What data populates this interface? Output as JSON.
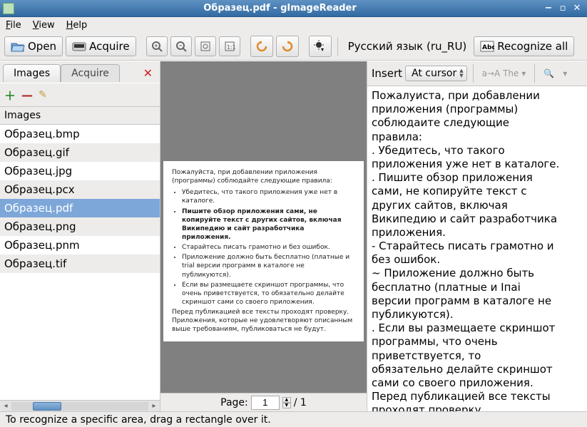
{
  "window": {
    "title": "Образец.pdf - gImageReader"
  },
  "menu": {
    "file": "File",
    "view": "View",
    "help": "Help"
  },
  "toolbar": {
    "open": "Open",
    "acquire": "Acquire",
    "language": "Русский язык (ru_RU)",
    "recognize_all": "Recognize all"
  },
  "sidebar": {
    "tab_images": "Images",
    "tab_acquire": "Acquire",
    "header": "Images",
    "files": [
      "Образец.bmp",
      "Образец.gif",
      "Образец.jpg",
      "Образец.pcx",
      "Образец.pdf",
      "Образец.png",
      "Образец.pnm",
      "Образец.tif"
    ],
    "selected_index": 4
  },
  "viewer": {
    "page_label": "Page:",
    "page_current": "1",
    "page_total": "/ 1",
    "preview": {
      "intro": "Пожалуйста, при добавлении приложения (программы) соблюдайте следующие правила:",
      "li1": "Убедитесь, что такого приложения уже нет в каталоге.",
      "li2": "Пишите обзор приложения сами, не копируйте текст с других сайтов, включая Википедию и сайт разработчика приложения.",
      "li3": "Старайтесь писать грамотно и без ошибок.",
      "li4": "Приложение должно быть бесплатно (платные и trial версии программ в каталоге не публикуются).",
      "li5": "Если вы размещаете скриншот программы, что очень приветствуется, то обязательно делайте скриншот сами со своего приложения.",
      "outro": "Перед публикацией все тексты проходят проверку. Приложения, которые не удовлетворяют описанным выше требованиям, публиковаться не будут."
    }
  },
  "output": {
    "insert_label": "Insert",
    "insert_mode": "At cursor",
    "the_label": "The",
    "text": "Пожалуиста, при добавлении\nприложения (программы)\nсоблюдаите следующие\nправила:\n. Убедитесь, что такого\nприложения уже нет в каталоге.\n. Пишите обзор приложения\nсами, не копируйте текст с\nдругих сайтов, включая\nВикипедию и сайт разработчика\nприложения.\n- Старайтесь писать грамотно и\nбез ошибок.\n~ Приложение должно быть\nбесплатно (платные и Іпаі\nверсии программ в каталоге не\nпубликуются).\n. Если вы размещаете скриншот\nпрограммы, что очень\nприветствуется, то\nобязательно делайте скриншот\nсами со своего приложения.\nПеред публикацией все тексты\nпроходят проверку.\nПриложения  которые  не"
  },
  "status": {
    "hint": "To recognize a specific area, drag a rectangle over it."
  }
}
